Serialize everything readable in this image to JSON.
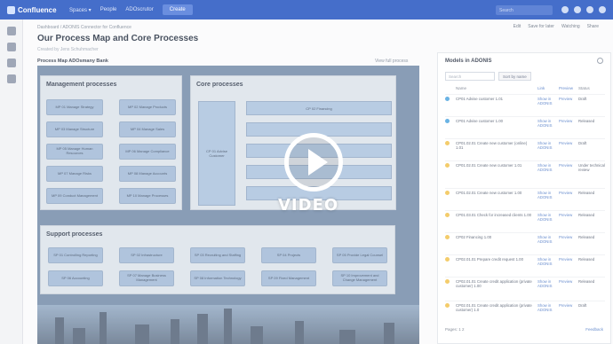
{
  "topbar": {
    "app_name": "Confluence",
    "nav": [
      "Spaces ▾",
      "People",
      "ADOscrutor"
    ],
    "create": "Create",
    "search_placeholder": "Search"
  },
  "page": {
    "breadcrumb": "Dashboard / ADONIS Connector for Confluence",
    "title": "Our Process Map and Core Processes",
    "meta": "Created by Jens Schuhmacher",
    "actions": [
      "Edit",
      "Save for later",
      "Watching",
      "Share"
    ]
  },
  "map": {
    "title": "Process Map ADOsmany Bank",
    "link": "View full process",
    "management": {
      "title": "Management processes",
      "items": [
        "MP 01 Manage Strategy",
        "MP 02 Manage Products",
        "MP 03 Manage Structure",
        "MP 04 Manage Sales",
        "MP 05 Manage Human Resources",
        "MP 06 Manage Compliance",
        "MP 07 Manage Risks",
        "MP 08 Manage Accounts",
        "MP 09 Conduct Management",
        "MP 10 Manage Processes"
      ]
    },
    "core": {
      "title": "Core processes",
      "left": "CP 01 Advise Customer",
      "bars": [
        "CP 02 Financing",
        "",
        "",
        "",
        ""
      ]
    },
    "support": {
      "title": "Support processes",
      "items": [
        "SP 01 Controlling Reporting",
        "SP 02 Infrastructure",
        "SP 03 Recruiting and Staffing",
        "SP 04 Projects",
        "SP 05 Provide Legal Counsel",
        "SP 06 Accounting",
        "SP 07 Manage Business Management",
        "SP 08 Information Technology",
        "SP 09 Fixed Management",
        "SP 10 Improvement and Change Management"
      ]
    }
  },
  "video": {
    "label": "VIDEO"
  },
  "models": {
    "title": "Models in ADONIS",
    "search_placeholder": "Search",
    "sort_label": "Sort by name",
    "headers": [
      "",
      "Name",
      "Link",
      "Preview",
      "Status"
    ],
    "rows": [
      {
        "name": "CP01 Advise customer 1.01",
        "link": "Show in ADONIS",
        "preview": "Preview",
        "status": "Draft"
      },
      {
        "name": "CP01 Advise customer 1.00",
        "link": "Show in ADONIS",
        "preview": "Preview",
        "status": "Released"
      },
      {
        "name": "CP01.02.01 Create new customer (online) 1.01",
        "link": "Show in ADONIS",
        "preview": "Preview",
        "status": "Draft"
      },
      {
        "name": "CP01.02.01 Create new customer 1.01",
        "link": "Show in ADONIS",
        "preview": "Preview",
        "status": "Under technical review"
      },
      {
        "name": "CP01.02.01 Create new customer 1.00",
        "link": "Show in ADONIS",
        "preview": "Preview",
        "status": "Released"
      },
      {
        "name": "CP01.03.01 Check for increased clients 1.00",
        "link": "Show in ADONIS",
        "preview": "Preview",
        "status": "Released"
      },
      {
        "name": "CP02 Financing 1.00",
        "link": "Show in ADONIS",
        "preview": "Preview",
        "status": "Released"
      },
      {
        "name": "CP02.01.01 Prepare credit request 1.00",
        "link": "Show in ADONIS",
        "preview": "Preview",
        "status": "Released"
      },
      {
        "name": "CP02.01.01 Create credit application (private customer) 1.00",
        "link": "Show in ADONIS",
        "preview": "Preview",
        "status": "Released"
      },
      {
        "name": "CP02.01.01 Create credit application (private customer) 1.0",
        "link": "Show in ADONIS",
        "preview": "Preview",
        "status": "Draft"
      }
    ],
    "pages": "Pages: 1  2",
    "feedback": "Feedback"
  }
}
